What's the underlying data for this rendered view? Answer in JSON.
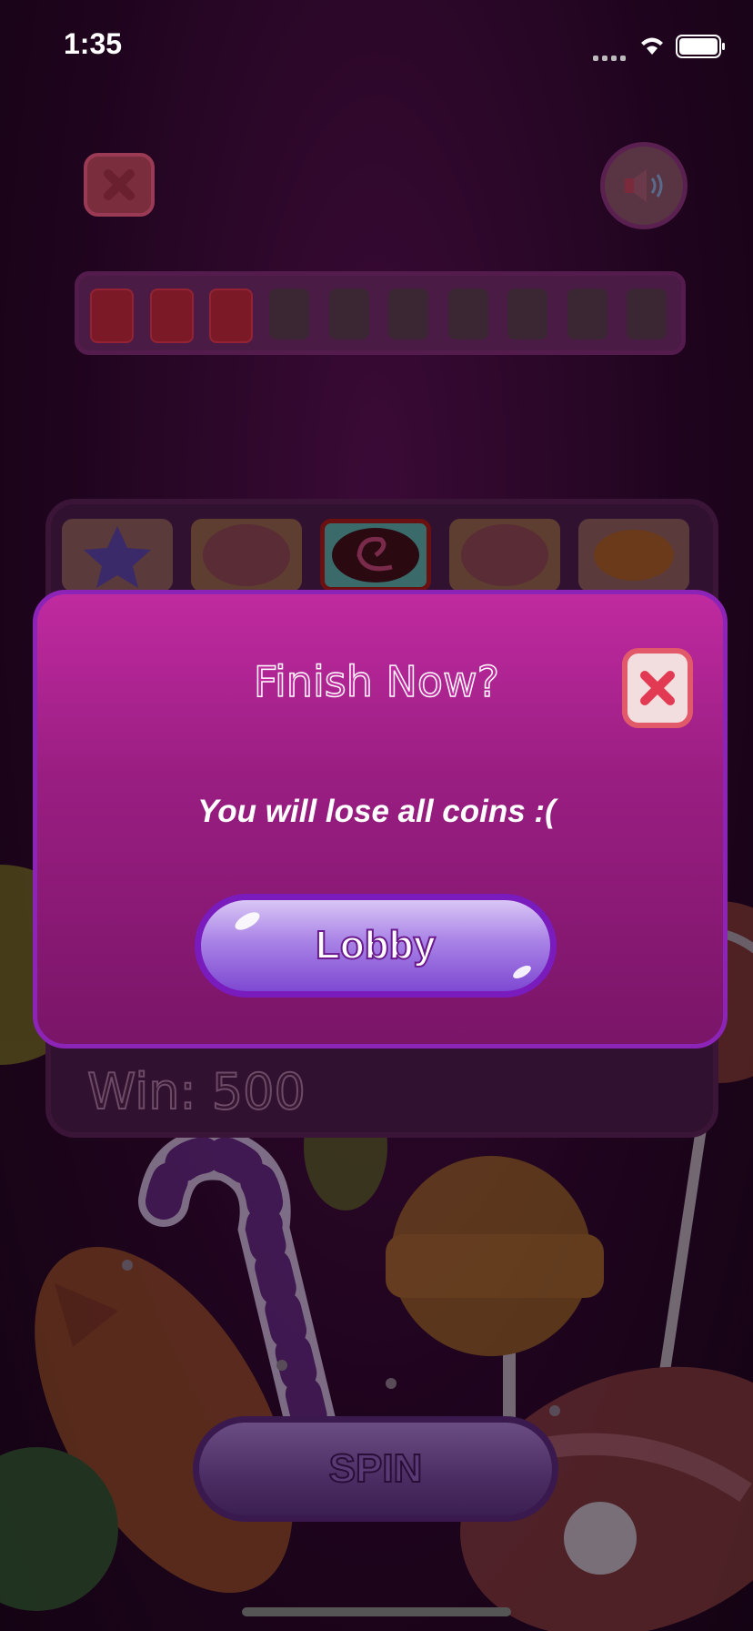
{
  "status_bar": {
    "time": "1:35"
  },
  "top_controls": {
    "close_icon": "close-icon",
    "sound_icon": "speaker-icon"
  },
  "progress": {
    "jars_total": 10,
    "jars_filled": 3,
    "icon": "heart-jar-icon"
  },
  "reels": {
    "visible_symbols": [
      "star-candy",
      "cookie",
      "swirl-donut",
      "cookie",
      "orange-candy"
    ],
    "selected_index": 2
  },
  "win": {
    "label": "Win: 500"
  },
  "dialog": {
    "title": "Finish Now?",
    "message": "You will lose all coins :(",
    "primary_button": "Lobby",
    "close_icon": "close-icon"
  },
  "spin_button": {
    "label": "SPIN"
  },
  "colors": {
    "dialog_bg": "#9a1e82",
    "dialog_border": "#8c24b8",
    "button_purple": "#a983e6",
    "close_red": "#e25a6a"
  }
}
